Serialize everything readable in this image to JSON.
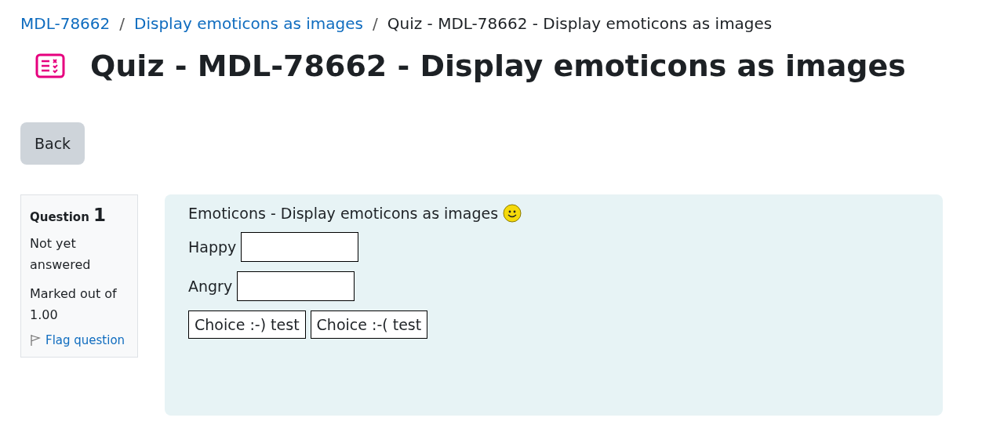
{
  "breadcrumbs": [
    {
      "label": "MDL-78662",
      "link": true
    },
    {
      "label": "Display emoticons as images",
      "link": true
    },
    {
      "label": "Quiz - MDL-78662 - Display emoticons as images",
      "link": false
    }
  ],
  "breadcrumb_separator": "/",
  "title": "Quiz - MDL-78662 - Display emoticons as images",
  "back_button": "Back",
  "question_info": {
    "label": "Question",
    "number": "1",
    "status": "Not yet answered",
    "marks": "Marked out of 1.00",
    "flag": "Flag question"
  },
  "question": {
    "text": "Emoticons - Display emoticons as images",
    "fields": [
      {
        "label": "Happy"
      },
      {
        "label": "Angry"
      }
    ],
    "choices": [
      "Choice :-) test",
      "Choice :-( test"
    ]
  }
}
